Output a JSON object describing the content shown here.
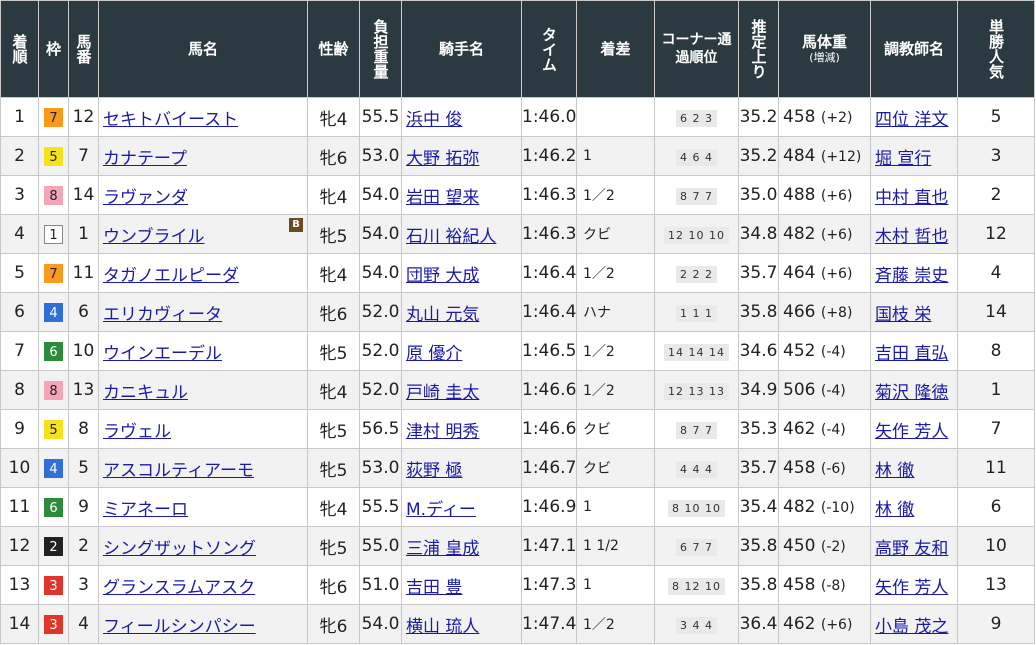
{
  "headers": {
    "rank": "着順",
    "waku": "枠",
    "num": "馬番",
    "name": "馬名",
    "sexage": "性齢",
    "weight": "負担重量",
    "jockey": "騎手名",
    "time": "タイム",
    "margin": "着差",
    "corner": "コーナー通過順位",
    "last3f": "推定上り",
    "body": "馬体重",
    "body_sub": "(増減)",
    "trainer": "調教師名",
    "pop": "単勝人気"
  },
  "waku_colors": {
    "1": {
      "bg": "#ffffff",
      "fg": "#222222",
      "border": "#888888"
    },
    "2": {
      "bg": "#222222",
      "fg": "#ffffff",
      "border": "#222222"
    },
    "3": {
      "bg": "#e0342c",
      "fg": "#ffffff",
      "border": "#e0342c"
    },
    "4": {
      "bg": "#2f6fd6",
      "fg": "#ffffff",
      "border": "#2f6fd6"
    },
    "5": {
      "bg": "#f5e21a",
      "fg": "#222222",
      "border": "#f5e21a"
    },
    "6": {
      "bg": "#2e8b3c",
      "fg": "#ffffff",
      "border": "#2e8b3c"
    },
    "7": {
      "bg": "#f79a1e",
      "fg": "#222222",
      "border": "#f79a1e"
    },
    "8": {
      "bg": "#f4a6b8",
      "fg": "#222222",
      "border": "#f4a6b8"
    }
  },
  "rows": [
    {
      "rank": "1",
      "waku": "7",
      "num": "12",
      "name": "セキトバイースト",
      "blinker": "",
      "sexage": "牝4",
      "weight": "55.5",
      "jockey": "浜中 俊",
      "time": "1:46.0",
      "margin": "",
      "corner": "6 2 3",
      "last3f": "35.2",
      "body": "458",
      "diff": "(+2)",
      "trainer": "四位 洋文",
      "pop": "5"
    },
    {
      "rank": "2",
      "waku": "5",
      "num": "7",
      "name": "カナテープ",
      "blinker": "",
      "sexage": "牝6",
      "weight": "53.0",
      "jockey": "大野 拓弥",
      "time": "1:46.2",
      "margin": "1",
      "corner": "4 6 4",
      "last3f": "35.2",
      "body": "484",
      "diff": "(+12)",
      "trainer": "堀 宣行",
      "pop": "3"
    },
    {
      "rank": "3",
      "waku": "8",
      "num": "14",
      "name": "ラヴァンダ",
      "blinker": "",
      "sexage": "牝4",
      "weight": "54.0",
      "jockey": "岩田 望来",
      "time": "1:46.3",
      "margin": "1／2",
      "corner": "8 7 7",
      "last3f": "35.0",
      "body": "488",
      "diff": "(+6)",
      "trainer": "中村 直也",
      "pop": "2"
    },
    {
      "rank": "4",
      "waku": "1",
      "num": "1",
      "name": "ウンブライル",
      "blinker": "B",
      "sexage": "牝5",
      "weight": "54.0",
      "jockey": "石川 裕紀人",
      "time": "1:46.3",
      "margin": "クビ",
      "corner": "12 10 10",
      "last3f": "34.8",
      "body": "482",
      "diff": "(+6)",
      "trainer": "木村 哲也",
      "pop": "12"
    },
    {
      "rank": "5",
      "waku": "7",
      "num": "11",
      "name": "タガノエルピーダ",
      "blinker": "",
      "sexage": "牝4",
      "weight": "54.0",
      "jockey": "団野 大成",
      "time": "1:46.4",
      "margin": "1／2",
      "corner": "2 2 2",
      "last3f": "35.7",
      "body": "464",
      "diff": "(+6)",
      "trainer": "斉藤 崇史",
      "pop": "4"
    },
    {
      "rank": "6",
      "waku": "4",
      "num": "6",
      "name": "エリカヴィータ",
      "blinker": "",
      "sexage": "牝6",
      "weight": "52.0",
      "jockey": "丸山 元気",
      "time": "1:46.4",
      "margin": "ハナ",
      "corner": "1 1 1",
      "last3f": "35.8",
      "body": "466",
      "diff": "(+8)",
      "trainer": "国枝 栄",
      "pop": "14"
    },
    {
      "rank": "7",
      "waku": "6",
      "num": "10",
      "name": "ウインエーデル",
      "blinker": "",
      "sexage": "牝5",
      "weight": "52.0",
      "jockey": "原 優介",
      "time": "1:46.5",
      "margin": "1／2",
      "corner": "14 14 14",
      "last3f": "34.6",
      "body": "452",
      "diff": "(-4)",
      "trainer": "吉田 直弘",
      "pop": "8"
    },
    {
      "rank": "8",
      "waku": "8",
      "num": "13",
      "name": "カニキュル",
      "blinker": "",
      "sexage": "牝4",
      "weight": "52.0",
      "jockey": "戸崎 圭太",
      "time": "1:46.6",
      "margin": "1／2",
      "corner": "12 13 13",
      "last3f": "34.9",
      "body": "506",
      "diff": "(-4)",
      "trainer": "菊沢 隆徳",
      "pop": "1"
    },
    {
      "rank": "9",
      "waku": "5",
      "num": "8",
      "name": "ラヴェル",
      "blinker": "",
      "sexage": "牝5",
      "weight": "56.5",
      "jockey": "津村 明秀",
      "time": "1:46.6",
      "margin": "クビ",
      "corner": "8 7 7",
      "last3f": "35.3",
      "body": "462",
      "diff": "(-4)",
      "trainer": "矢作 芳人",
      "pop": "7"
    },
    {
      "rank": "10",
      "waku": "4",
      "num": "5",
      "name": "アスコルティアーモ",
      "blinker": "",
      "sexage": "牝5",
      "weight": "53.0",
      "jockey": "荻野 極",
      "time": "1:46.7",
      "margin": "クビ",
      "corner": "4 4 4",
      "last3f": "35.7",
      "body": "458",
      "diff": "(-6)",
      "trainer": "林 徹",
      "pop": "11"
    },
    {
      "rank": "11",
      "waku": "6",
      "num": "9",
      "name": "ミアネーロ",
      "blinker": "",
      "sexage": "牝4",
      "weight": "55.5",
      "jockey": "M.ディー",
      "time": "1:46.9",
      "margin": "1",
      "corner": "8 10 10",
      "last3f": "35.4",
      "body": "482",
      "diff": "(-10)",
      "trainer": "林 徹",
      "pop": "6"
    },
    {
      "rank": "12",
      "waku": "2",
      "num": "2",
      "name": "シングザットソング",
      "blinker": "",
      "sexage": "牝5",
      "weight": "55.0",
      "jockey": "三浦 皇成",
      "time": "1:47.1",
      "margin": "1 1/2",
      "corner": "6 7 7",
      "last3f": "35.8",
      "body": "450",
      "diff": "(-2)",
      "trainer": "高野 友和",
      "pop": "10"
    },
    {
      "rank": "13",
      "waku": "3",
      "num": "3",
      "name": "グランスラムアスク",
      "blinker": "",
      "sexage": "牝6",
      "weight": "51.0",
      "jockey": "吉田 豊",
      "time": "1:47.3",
      "margin": "1",
      "corner": "8 12 10",
      "last3f": "35.8",
      "body": "458",
      "diff": "(-8)",
      "trainer": "矢作 芳人",
      "pop": "13"
    },
    {
      "rank": "14",
      "waku": "3",
      "num": "4",
      "name": "フィールシンパシー",
      "blinker": "",
      "sexage": "牝6",
      "weight": "54.0",
      "jockey": "横山 琉人",
      "time": "1:47.4",
      "margin": "1／2",
      "corner": "3 4 4",
      "last3f": "36.4",
      "body": "462",
      "diff": "(+6)",
      "trainer": "小島 茂之",
      "pop": "9"
    }
  ]
}
